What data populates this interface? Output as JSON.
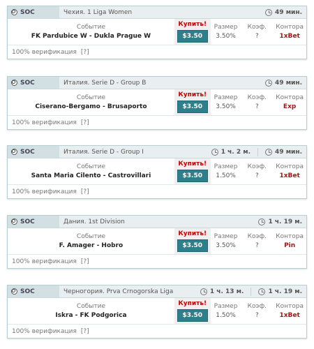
{
  "cards": [
    {
      "sport": "SOC",
      "league": "Чехия. 1 Liga Women",
      "timers": [
        "49 мин."
      ],
      "event_label": "Событие",
      "event": "FK Pardubice W - Dukla Prague W",
      "buy_label": "Купить!",
      "price": "$3.50",
      "size_label": "Размер",
      "size": "3.50%",
      "coef_label": "Коэф.",
      "coef": "?",
      "bk_label": "Контора",
      "bk": "1xBet",
      "verification": "100% верификация",
      "help": "[?]"
    },
    {
      "sport": "SOC",
      "league": "Италия. Serie D - Group B",
      "timers": [
        "49 мин."
      ],
      "event_label": "Событие",
      "event": "Ciserano-Bergamo - Brusaporto",
      "buy_label": "Купить!",
      "price": "$3.50",
      "size_label": "Размер",
      "size": "3.50%",
      "coef_label": "Коэф.",
      "coef": "?",
      "bk_label": "Контора",
      "bk": "Exp",
      "verification": "100% верификация",
      "help": "[?]"
    },
    {
      "sport": "SOC",
      "league": "Италия. Serie D - Group I",
      "timers": [
        "1 ч. 2 м.",
        "49 мин."
      ],
      "event_label": "Событие",
      "event": "Santa Maria Cilento - Castrovillari",
      "buy_label": "Купить!",
      "price": "$3.50",
      "size_label": "Размер",
      "size": "1.50%",
      "coef_label": "Коэф.",
      "coef": "?",
      "bk_label": "Контора",
      "bk": "1xBet",
      "verification": "100% верификация",
      "help": "[?]"
    },
    {
      "sport": "SOC",
      "league": "Дания. 1st Division",
      "timers": [
        "1 ч. 19 м."
      ],
      "event_label": "Событие",
      "event": "F. Amager - Hobro",
      "buy_label": "Купить!",
      "price": "$3.50",
      "size_label": "Размер",
      "size": "3.50%",
      "coef_label": "Коэф.",
      "coef": "?",
      "bk_label": "Контора",
      "bk": "Pin",
      "verification": "100% верификация",
      "help": "[?]"
    },
    {
      "sport": "SOC",
      "league": "Черногория. Prva Crnogorska Liga",
      "timers": [
        "1 ч. 13 м.",
        "1 ч. 19 м."
      ],
      "event_label": "Событие",
      "event": "Iskra - FK Podgorica",
      "buy_label": "Купить!",
      "price": "$3.50",
      "size_label": "Размер",
      "size": "1.50%",
      "coef_label": "Коэф.",
      "coef": "?",
      "bk_label": "Контора",
      "bk": "1xBet",
      "verification": "100% верификация",
      "help": "[?]"
    }
  ]
}
